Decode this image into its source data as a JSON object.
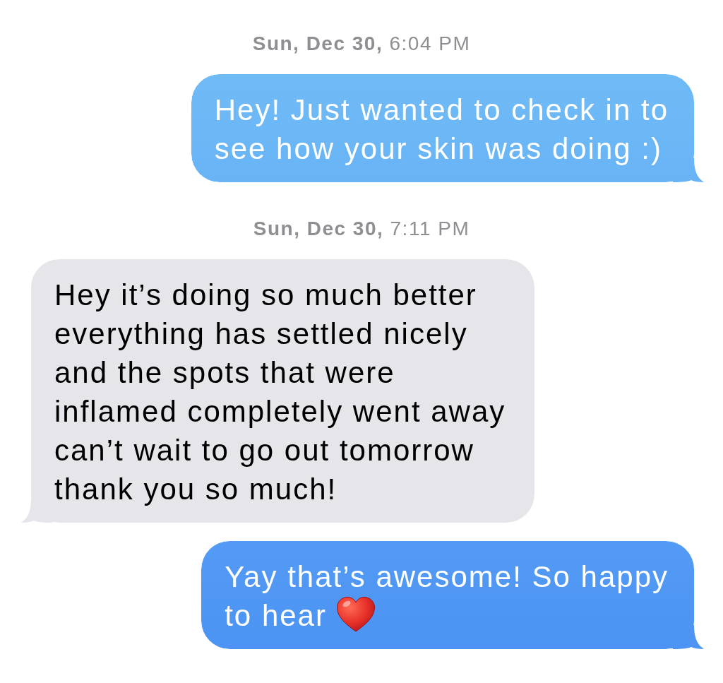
{
  "conversation": [
    {
      "kind": "timestamp",
      "text": "**Sun, Dec 30,** 6:04 PM"
    },
    {
      "kind": "sent",
      "text": "Hey! Just wanted to check in to\nsee how your skin was doing :)"
    },
    {
      "kind": "timestamp",
      "text": "**Sun, Dec 30,** 7:11 PM"
    },
    {
      "kind": "received",
      "text": "Hey it’s doing so much better\neverything has settled nicely\nand the spots that were\ninflamed completely went away\ncan’t wait to go out tomorrow\nthank you so much!"
    },
    {
      "kind": "sent",
      "text": "Yay that’s awesome! So happy\nto hear",
      "emoji": true
    }
  ]
}
